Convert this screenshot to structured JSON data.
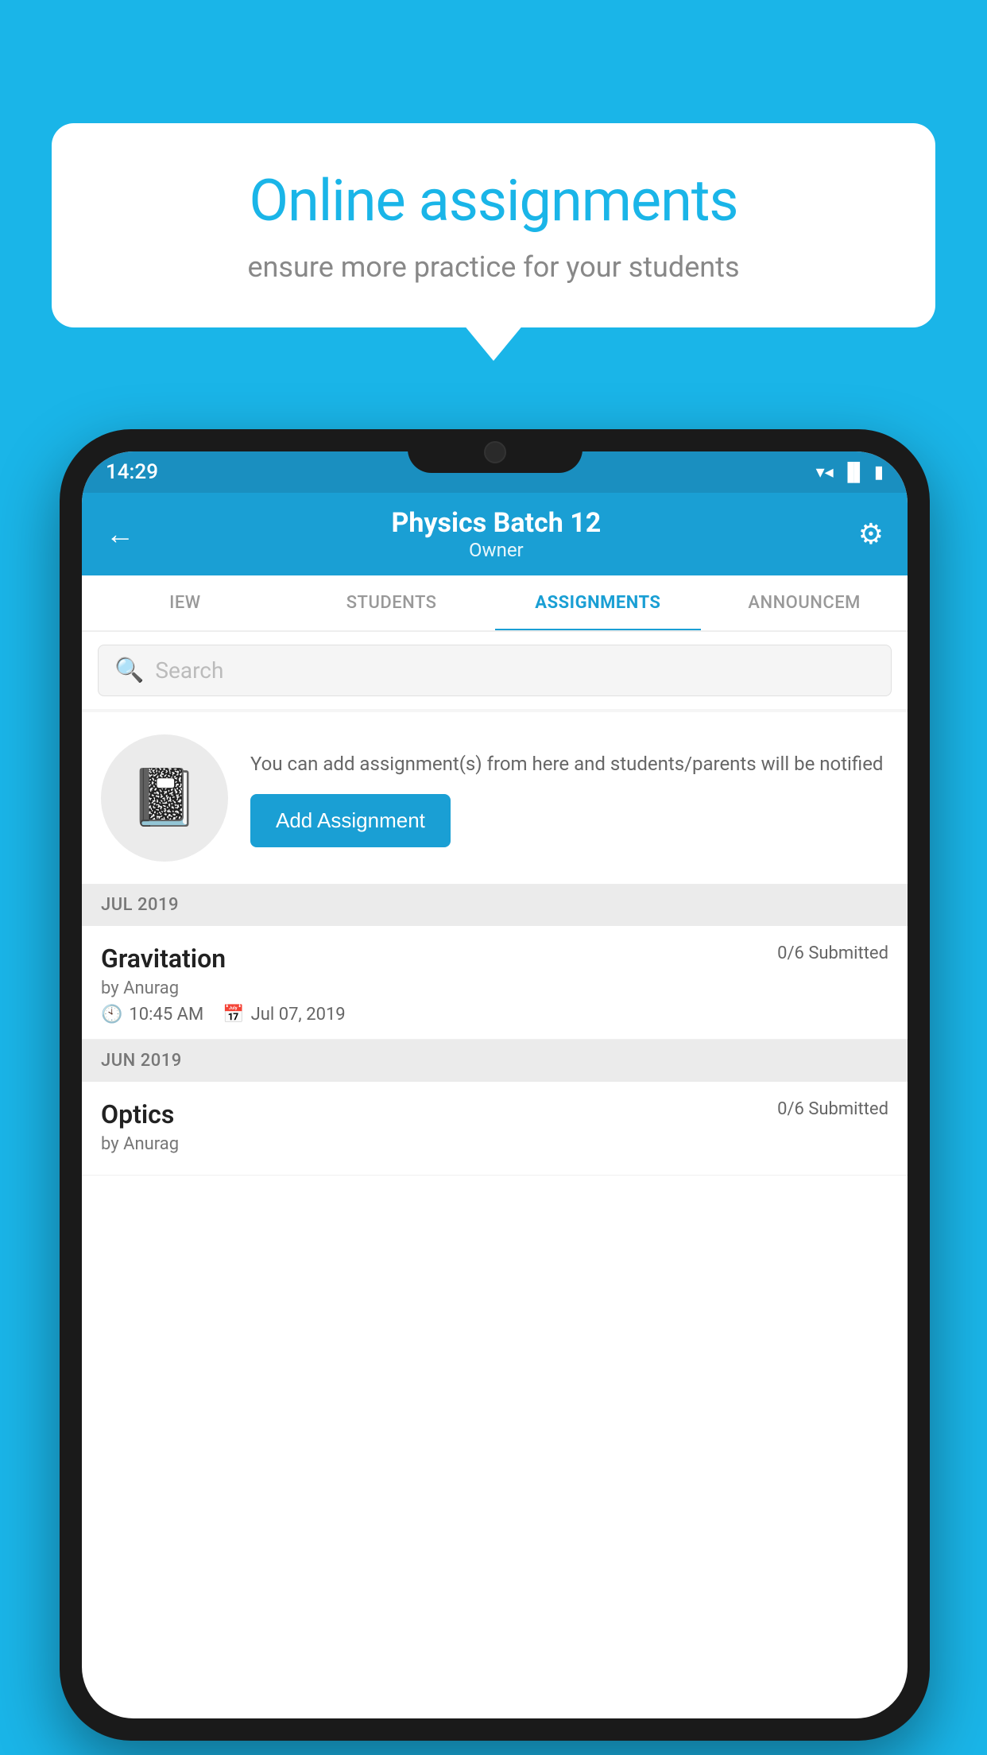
{
  "background": {
    "color": "#1ab5e8"
  },
  "speech_bubble": {
    "title": "Online assignments",
    "subtitle": "ensure more practice for your students"
  },
  "phone": {
    "status_bar": {
      "time": "14:29",
      "icons": [
        "▼",
        "▲",
        "▐"
      ]
    },
    "header": {
      "back_label": "←",
      "title": "Physics Batch 12",
      "subtitle": "Owner",
      "gear_label": "⚙"
    },
    "tabs": [
      {
        "label": "IEW",
        "active": false
      },
      {
        "label": "STUDENTS",
        "active": false
      },
      {
        "label": "ASSIGNMENTS",
        "active": true
      },
      {
        "label": "ANNOUNCEM",
        "active": false
      }
    ],
    "search": {
      "placeholder": "Search",
      "icon": "🔍"
    },
    "promo": {
      "description": "You can add assignment(s) from here and students/parents will be notified",
      "button_label": "Add Assignment"
    },
    "sections": [
      {
        "header": "JUL 2019",
        "assignments": [
          {
            "name": "Gravitation",
            "submitted": "0/6 Submitted",
            "by": "by Anurag",
            "time": "10:45 AM",
            "date": "Jul 07, 2019"
          }
        ]
      },
      {
        "header": "JUN 2019",
        "assignments": [
          {
            "name": "Optics",
            "submitted": "0/6 Submitted",
            "by": "by Anurag",
            "time": "",
            "date": ""
          }
        ]
      }
    ]
  }
}
